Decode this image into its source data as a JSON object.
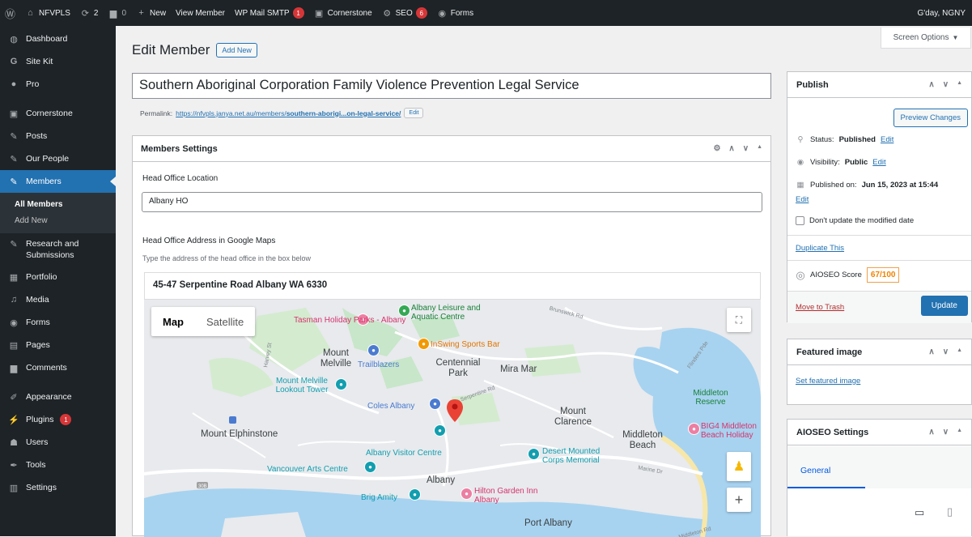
{
  "adminbar": {
    "site": "NFVPLS",
    "updates": "2",
    "comments": "0",
    "new": "New",
    "view_member": "View Member",
    "wp_mail": "WP Mail SMTP",
    "wp_mail_badge": "1",
    "cornerstone": "Cornerstone",
    "seo": "SEO",
    "seo_badge": "6",
    "forms": "Forms",
    "greeting": "G'day, NGNY"
  },
  "sidebar": {
    "items": [
      {
        "label": "Dashboard",
        "icon": "dashboard-icon"
      },
      {
        "label": "Site Kit",
        "icon": "sitekit-icon"
      },
      {
        "label": "Pro",
        "icon": "pro-icon"
      },
      {
        "label": "Cornerstone",
        "icon": "cornerstone-icon"
      },
      {
        "label": "Posts",
        "icon": "pin-icon"
      },
      {
        "label": "Our People",
        "icon": "pin-icon"
      },
      {
        "label": "Members",
        "icon": "pin-icon"
      },
      {
        "label": "Research and Submissions",
        "icon": "pin-icon"
      },
      {
        "label": "Portfolio",
        "icon": "portfolio-icon"
      },
      {
        "label": "Media",
        "icon": "media-icon"
      },
      {
        "label": "Forms",
        "icon": "forms-icon"
      },
      {
        "label": "Pages",
        "icon": "pages-icon"
      },
      {
        "label": "Comments",
        "icon": "comments-icon"
      },
      {
        "label": "Appearance",
        "icon": "appearance-icon"
      },
      {
        "label": "Plugins",
        "icon": "plugins-icon",
        "badge": "1"
      },
      {
        "label": "Users",
        "icon": "users-icon"
      },
      {
        "label": "Tools",
        "icon": "tools-icon"
      },
      {
        "label": "Settings",
        "icon": "settings-icon"
      }
    ],
    "submenu": [
      "All Members",
      "Add New"
    ]
  },
  "screen_options": "Screen Options",
  "page": {
    "title": "Edit Member",
    "add_new": "Add New",
    "post_title": "Southern Aboriginal Corporation Family Violence Prevention Legal Service",
    "permalink_label": "Permalink:",
    "permalink_base": "https://nfvpls.janya.net.au/members/",
    "permalink_slug": "southern-aborigi...on-legal-service/",
    "permalink_edit": "Edit"
  },
  "members_settings": {
    "title": "Members Settings",
    "head_office_label": "Head Office Location",
    "head_office_value": "Albany HO",
    "maps_label": "Head Office Address in Google Maps",
    "maps_help": "Type the address of the head office in the box below",
    "address": "45-47 Serpentine Road Albany WA 6330"
  },
  "map": {
    "tab_map": "Map",
    "tab_satellite": "Satellite",
    "labels": {
      "tasman": "Tasman Holiday Parks - Albany",
      "leisure": "Albany Leisure and Aquatic Centre",
      "inswing": "InSwing Sports Bar",
      "mount_melville": "Mount Melville",
      "trailblazers": "Trailblazers",
      "centennial": "Centennial Park",
      "mira_mar": "Mira Mar",
      "lookout": "Mount Melville Lookout Tower",
      "coles": "Coles Albany",
      "mount_clarence": "Mount Clarence",
      "middleton_reserve": "Middleton Reserve",
      "big4": "BIG4 Middleton Beach Holiday",
      "mount_elphinstone": "Mount Elphinstone",
      "visitor_centre": "Albany Visitor Centre",
      "desert_mounted": "Desert Mounted Corps Memorial",
      "middleton_beach": "Middleton Beach",
      "vancouver": "Vancouver Arts Centre",
      "albany": "Albany",
      "brig_amity": "Brig Amity",
      "hilton": "Hilton Garden Inn Albany",
      "port_albany": "Port Albany",
      "road_harvey": "Harvey St",
      "road_brunswick": "Brunswick Rd",
      "road_serpentine": "Serpentine Rd",
      "road_flinders": "Flinders Pde",
      "road_marine": "Marine Dr",
      "road_middleton": "Middleton Rd",
      "hwy": "30B"
    }
  },
  "publish": {
    "title": "Publish",
    "preview": "Preview Changes",
    "status_label": "Status:",
    "status_value": "Published",
    "status_edit": "Edit",
    "visibility_label": "Visibility:",
    "visibility_value": "Public",
    "visibility_edit": "Edit",
    "published_label": "Published on:",
    "published_value": "Jun 15, 2023 at 15:44",
    "published_edit": "Edit",
    "dont_update": "Don't update the modified date",
    "duplicate": "Duplicate This",
    "aioseo_label": "AIOSEO Score",
    "aioseo_score": "67/100",
    "trash": "Move to Trash",
    "update": "Update"
  },
  "featured": {
    "title": "Featured image",
    "set": "Set featured image"
  },
  "aioseo": {
    "title": "AIOSEO Settings",
    "tab_general": "General"
  },
  "colors": {
    "wp_blue": "#2271b1",
    "adminbar_bg": "#1d2327",
    "pin_red": "#ea4335",
    "badge_red": "#d63638"
  }
}
